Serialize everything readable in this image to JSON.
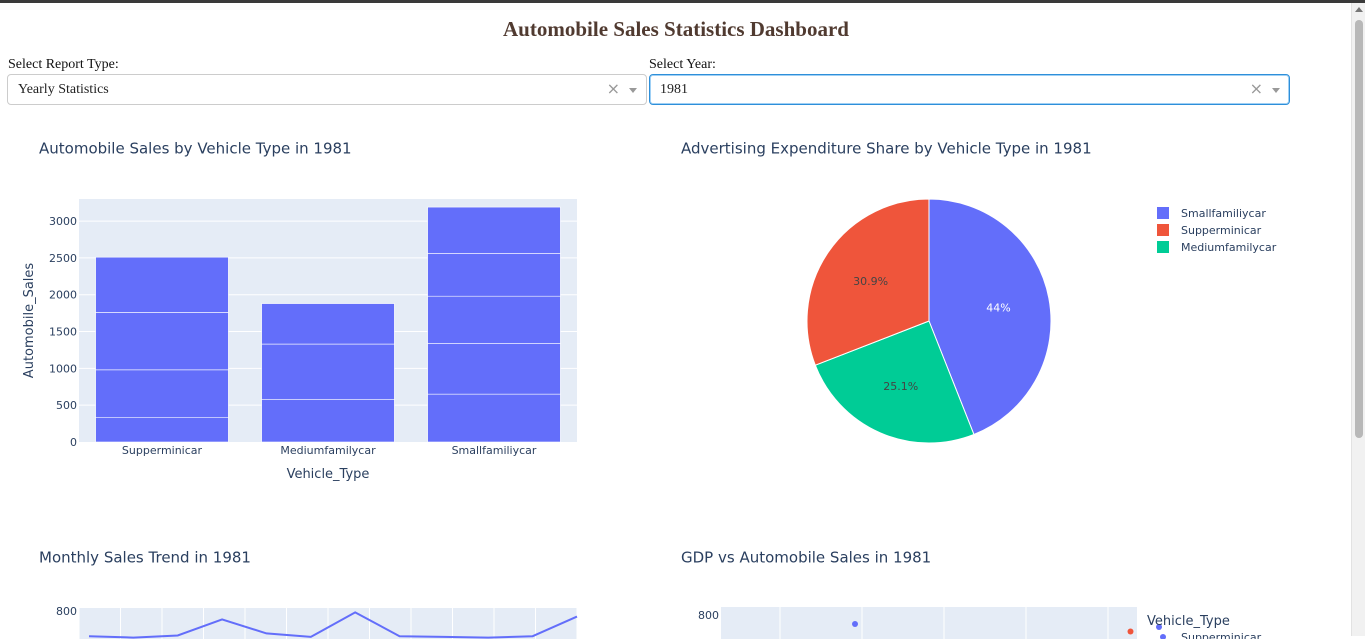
{
  "page": {
    "title": "Automobile Sales Statistics Dashboard"
  },
  "controls": {
    "report_type": {
      "label": "Select Report Type:",
      "value": "Yearly Statistics"
    },
    "year": {
      "label": "Select Year:",
      "value": "1981"
    },
    "clear_symbol": "×"
  },
  "colors": {
    "blue": "#636efa",
    "red": "#ef553b",
    "green": "#00cc96",
    "plot_bg": "#e5ecf6",
    "text": "#2a3f5f"
  },
  "chart_data": [
    {
      "type": "bar",
      "title": "Automobile Sales by Vehicle Type in 1981",
      "xlabel": "Vehicle_Type",
      "ylabel": "Automobile_Sales",
      "categories": [
        "Supperminicar",
        "Mediumfamilycar",
        "Smallfamiliycar"
      ],
      "values": [
        2510,
        1880,
        3190
      ],
      "stack_segments": [
        [
          330,
          650,
          780,
          750
        ],
        [
          580,
          750,
          550
        ],
        [
          650,
          690,
          640,
          580,
          630
        ]
      ],
      "ylim": [
        0,
        3300
      ],
      "yticks": [
        0,
        500,
        1000,
        1500,
        2000,
        2500,
        3000
      ],
      "ytick_labels": [
        "0",
        "500",
        "1000",
        "1500",
        "2000",
        "2500",
        "3000"
      ]
    },
    {
      "type": "pie",
      "title": "Advertising Expenditure Share by Vehicle Type in 1981",
      "legend_position": "top-right",
      "slices": [
        {
          "label": "Smallfamiliycar",
          "value": 44,
          "text": "44%"
        },
        {
          "label": "Mediumfamilycar",
          "value": 25.1,
          "text": "25.1%"
        },
        {
          "label": "Supperminicar",
          "value": 30.9,
          "text": "30.9%"
        }
      ],
      "legend": [
        "Smallfamiliycar",
        "Supperminicar",
        "Mediumfamilycar"
      ]
    },
    {
      "type": "line",
      "title": "Monthly Sales Trend in 1981",
      "ytick_labels": [
        "800"
      ],
      "visible_values": [
        {
          "x": 1,
          "y": 620
        },
        {
          "x": 2,
          "y": 610
        },
        {
          "x": 3,
          "y": 625
        },
        {
          "x": 4,
          "y": 740
        },
        {
          "x": 5,
          "y": 640
        },
        {
          "x": 6,
          "y": 615
        },
        {
          "x": 7,
          "y": 790
        },
        {
          "x": 8,
          "y": 620
        },
        {
          "x": 9,
          "y": 615
        },
        {
          "x": 10,
          "y": 610
        },
        {
          "x": 11,
          "y": 620
        },
        {
          "x": 12,
          "y": 760
        }
      ]
    },
    {
      "type": "scatter",
      "title": "GDP vs Automobile Sales in 1981",
      "ytick_labels": [
        "800"
      ],
      "legend_title": "Vehicle_Type",
      "legend": [
        "Supperminicar"
      ],
      "points": [
        {
          "x": 1,
          "y": 770,
          "series": "Supperminicar"
        },
        {
          "x": 2.6,
          "y": 760,
          "series": "Supperminicar"
        },
        {
          "x": 2.45,
          "y": 745,
          "series": "Mediumfamilycar"
        }
      ]
    }
  ]
}
